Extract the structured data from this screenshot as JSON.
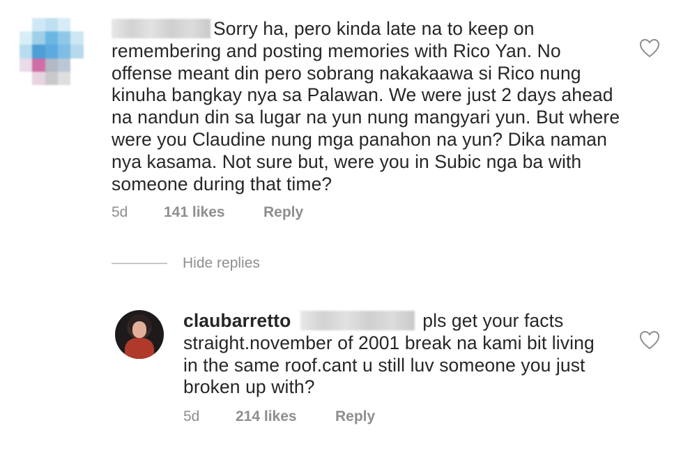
{
  "comment": {
    "text": "Sorry ha, pero kinda late na to keep on remembering and posting memories with Rico Yan. No offense meant din pero sobrang nakakaawa si Rico nung kinuha bangkay nya sa Palawan. We were just 2 days ahead na nandun din sa lugar na yun nung mangyari yun. But where were you Claudine nung mga panahon na yun? Dika naman nya kasama. Not sure but, were you in Subic nga ba with someone during that time?",
    "lines": [
      "Sorry ha, pero kinda late na to keep on",
      "remembering and posting memories with Rico Yan. No",
      "offense meant din pero sobrang nakakaawa si Rico nung",
      "kinuha bangkay nya sa Palawan. We were just 2 days ahead",
      "na nandun din sa lugar na yun nung mangyari yun. But where",
      "were you Claudine nung mga panahon na yun? Dika naman",
      "nya kasama. Not sure but, were you in Subic nga ba with",
      "someone during that time?"
    ],
    "age": "5d",
    "likes": "141 likes",
    "reply_label": "Reply",
    "like_icon": "heart-outline-icon"
  },
  "replies_toggle": {
    "label": "Hide replies"
  },
  "reply": {
    "username": "claubarretto",
    "lines": [
      "pls get your facts",
      "straight.november of 2001 break na kami bit living",
      "in the same roof.cant u still luv someone you just",
      "broken up with?"
    ],
    "age": "5d",
    "likes": "214 likes",
    "reply_label": "Reply",
    "like_icon": "heart-outline-icon"
  },
  "colors": {
    "text": "#262626",
    "secondary": "#8e8e8e",
    "divider": "#c7c7c7"
  }
}
